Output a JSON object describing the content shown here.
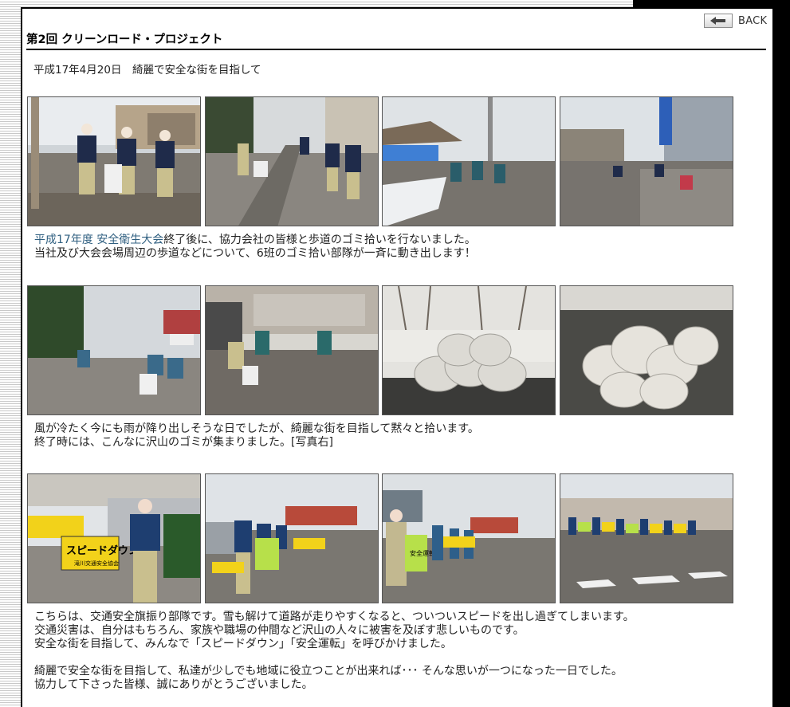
{
  "header": {
    "title": "第2回 クリーンロード・プロジェクト",
    "back_label": "BACK"
  },
  "date_line": "平成17年4月20日　綺麗で安全な街を目指して",
  "sections": [
    {
      "caption": {
        "link": "平成17年度 安全衛生大会",
        "line1_rest": "終了後に、協力会社の皆様と歩道のゴミ拾いを行ないました。",
        "line2": "当社及び大会会場周辺の歩道などについて、6班のゴミ拾い部隊が一斉に動き出します！"
      }
    },
    {
      "caption": {
        "line1": "風が冷たく今にも雨が降り出しそうな日でしたが、綺麗な街を目指して黙々と拾います。",
        "line2": "終了時には、こんなに沢山のゴミが集まりました。[写真右]"
      }
    },
    {
      "banners": {
        "main": "スピードダウン",
        "sub": "滝川交通安全協会",
        "green": "安全運転"
      },
      "caption": {
        "line1": "こちらは、交通安全旗振り部隊です。雪も解けて道路が走りやすくなると、ついついスピードを出し過ぎてしまいます。",
        "line2": "交通災害は、自分はもちろん、家族や職場の仲間など沢山の人々に被害を及ぼす悲しいものです。",
        "line3": "安全な街を目指して、みんなで「スピードダウン」「安全運転」を呼びかけました。",
        "line4": "綺麗で安全な街を目指して、私達が少しでも地域に役立つことが出来れば･･･ そんな思いが一つになった一日でした。",
        "line5": "協力して下さった皆様、誠にありがとうございました。"
      }
    }
  ],
  "colors": {
    "link": "#2f5f80",
    "banner_yellow": "#f2d21a",
    "banner_green": "#b7e04a"
  }
}
